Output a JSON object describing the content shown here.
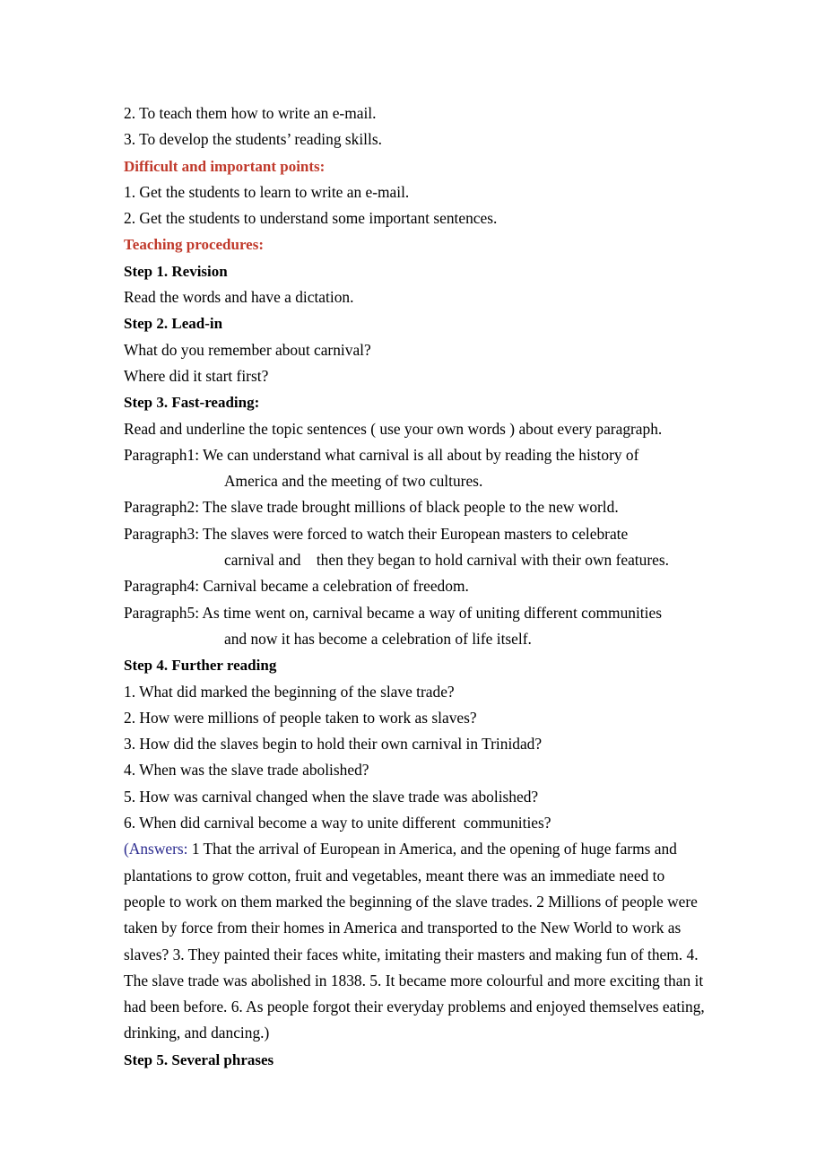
{
  "document": {
    "type": "lesson-plan",
    "colors": {
      "heading_red": "#C0392B",
      "answers_blue": "#2B2B8F",
      "body_text": "#000000",
      "background": "#FFFFFF"
    },
    "lines": [
      {
        "id": "objective-2",
        "text": "2. To teach them how to write an e-mail.",
        "style": "body"
      },
      {
        "id": "objective-3",
        "text": "3. To develop the students’ reading skills.",
        "style": "body"
      },
      {
        "id": "difficult-points-heading",
        "text": "Difficult and important points:",
        "style": "heading-red"
      },
      {
        "id": "difficult-point-1",
        "text": "1. Get the students to learn to write an e-mail.",
        "style": "body"
      },
      {
        "id": "difficult-point-2",
        "text": "2. Get the students to understand some important sentences.",
        "style": "body"
      },
      {
        "id": "teaching-procedures-heading",
        "text": "Teaching procedures:",
        "style": "heading-red"
      },
      {
        "id": "step-1-heading",
        "text": "Step 1. Revision",
        "style": "heading-step"
      },
      {
        "id": "step-1-body",
        "text": "Read the words and have a dictation.",
        "style": "body"
      },
      {
        "id": "step-2-heading",
        "text": "Step 2. Lead-in",
        "style": "heading-step"
      },
      {
        "id": "step-2-q1",
        "text": "What do you remember about carnival?",
        "style": "body"
      },
      {
        "id": "step-2-q2",
        "text": "Where did it start first?",
        "style": "body"
      },
      {
        "id": "step-3-heading",
        "text": "Step 3. Fast-reading:",
        "style": "heading-step"
      },
      {
        "id": "step-3-instruction",
        "text": "Read and underline the topic sentences ( use your own words ) about every paragraph.",
        "style": "body"
      },
      {
        "id": "paragraph-1",
        "text": "Paragraph1: We can understand what carnival is all about by reading the history of",
        "style": "body"
      },
      {
        "id": "paragraph-1-cont",
        "text": "America and the meeting of two cultures.",
        "style": "indent"
      },
      {
        "id": "paragraph-2",
        "text": "Paragraph2: The slave trade brought millions of black people to the new world.",
        "style": "body"
      },
      {
        "id": "paragraph-3",
        "text": "Paragraph3: The slaves were forced to watch their European masters to celebrate",
        "style": "body"
      },
      {
        "id": "paragraph-3-cont",
        "text": "carnival and    then they began to hold carnival with their own features.",
        "style": "indent"
      },
      {
        "id": "paragraph-4",
        "text": "Paragraph4: Carnival became a celebration of freedom.",
        "style": "body"
      },
      {
        "id": "paragraph-5",
        "text": "Paragraph5: As time went on, carnival became a way of uniting different communities",
        "style": "body"
      },
      {
        "id": "paragraph-5-cont",
        "text": "and now it has become a celebration of life itself.",
        "style": "indent"
      },
      {
        "id": "step-4-heading",
        "text": "Step 4. Further reading",
        "style": "heading-step"
      },
      {
        "id": "step-4-q1",
        "text": "1. What did marked the beginning of the slave trade?",
        "style": "body"
      },
      {
        "id": "step-4-q2",
        "text": "2. How were millions of people taken to work as slaves?",
        "style": "body"
      },
      {
        "id": "step-4-q3",
        "text": "3. How did the slaves begin to hold their own carnival in Trinidad?",
        "style": "body"
      },
      {
        "id": "step-4-q4",
        "text": "4. When was the slave trade abolished?",
        "style": "body"
      },
      {
        "id": "step-4-q5",
        "text": "5. How was carnival changed when the slave trade was abolished?",
        "style": "body"
      },
      {
        "id": "step-4-q6",
        "text": "6. When did carnival become a way to unite different  communities?",
        "style": "body"
      }
    ],
    "answers": {
      "lead_label": "(Answers:",
      "text": " 1 That the arrival of European in America, and the opening of huge farms and plantations to grow cotton, fruit and vegetables, meant there was an immediate need to people to work on them marked the beginning of the slave trades. 2 Millions of people were taken by force from their homes in America and transported to the New World to work as slaves? 3. They painted their faces white, imitating their masters and making fun of them. 4. The slave trade was abolished in 1838. 5. It became more colourful and more exciting than it had been before. 6. As people forgot their everyday problems and enjoyed themselves eating, drinking, and dancing.)"
    },
    "footer_heading": {
      "id": "step-5-heading",
      "text": "Step 5. Several phrases"
    }
  }
}
